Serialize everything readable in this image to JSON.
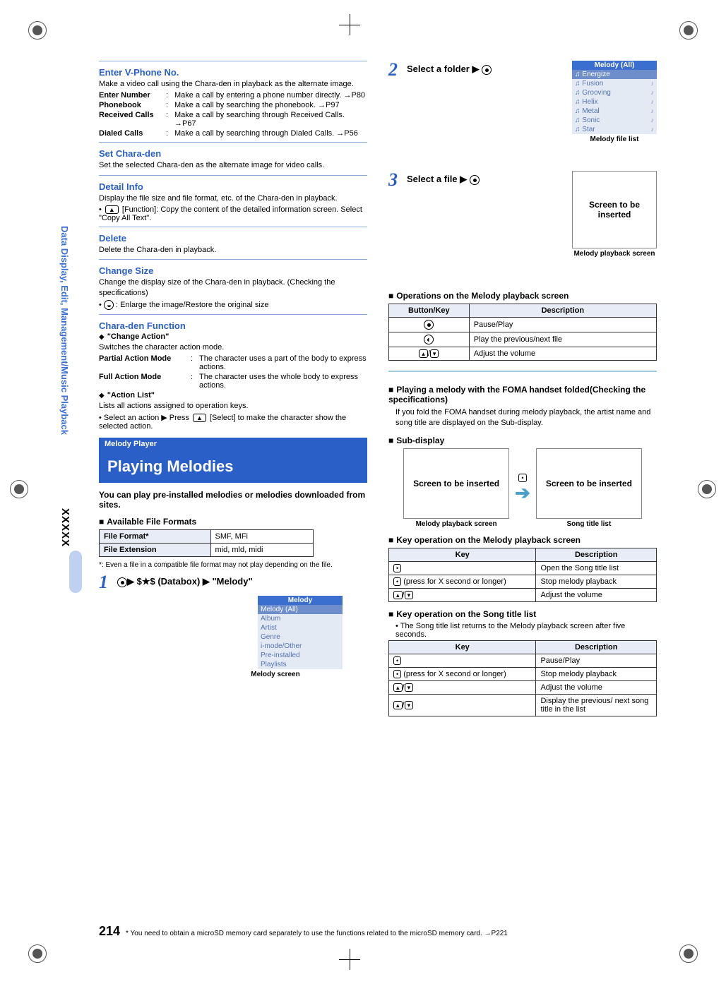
{
  "side": {
    "section": "Data Display, Edit, Management/Music Playback",
    "subcode": "XXXXX"
  },
  "left": {
    "vphone": {
      "title": "Enter V-Phone No.",
      "desc": "Make a video call using the Chara-den in playback as the alternate image.",
      "rows": [
        {
          "k": "Enter Number",
          "v": "Make a call by entering a phone number directly. →P80"
        },
        {
          "k": "Phonebook",
          "v": "Make a call by searching the phonebook. →P97"
        },
        {
          "k": "Received Calls",
          "v": "Make a call by searching through Received Calls. →P67"
        },
        {
          "k": "Dialed Calls",
          "v": "Make a call by searching through Dialed Calls. →P56"
        }
      ]
    },
    "setchara": {
      "title": "Set Chara-den",
      "desc": "Set the selected Chara-den as the alternate image for video calls."
    },
    "detail": {
      "title": "Detail Info",
      "desc": "Display the file size and file format, etc. of the Chara-den in playback.",
      "bullet_pre": "•",
      "bullet_post": " [Function]: Copy the content of the detailed information screen. Select \"Copy All Text\"."
    },
    "delete": {
      "title": "Delete",
      "desc": "Delete the Chara-den in playback."
    },
    "changesize": {
      "title": "Change Size",
      "desc": "Change the display size of the Chara-den in playback. (Checking the specifications)",
      "bullet": ": Enlarge the image/Restore the original size"
    },
    "charafn": {
      "title": "Chara-den Function",
      "changeaction": "\"Change Action\"",
      "changeaction_desc": "Switches the character action mode.",
      "rows": [
        {
          "k": "Partial Action Mode",
          "v": "The character uses a part of the body to express actions."
        },
        {
          "k": "Full Action Mode",
          "v": "The character uses the whole body to express actions."
        }
      ],
      "actionlist": "\"Action List\"",
      "actionlist_desc": "Lists all actions assigned to operation keys.",
      "actionlist_bullet": "Select an action ▶ Press ",
      "actionlist_bullet2": " [Select] to make the character show the selected action."
    },
    "feature": {
      "bar": "Melody Player",
      "title": "Playing Melodies",
      "lead": "You can play pre-installed melodies or melodies downloaded from sites.",
      "avail_head": "Available File Formats",
      "table": {
        "r1k": "File Format*",
        "r1v": "SMF, MFi",
        "r2k": "File Extension",
        "r2v": "mid, mld, midi"
      },
      "foot": "*: Even a file in a compatible file format may not play depending on the file.",
      "step1": "$★$ (Databox)  ▶  \"Melody\"",
      "menu_title": "Melody",
      "menu_items": [
        "Melody (All)",
        "Album",
        "Artist",
        "Genre",
        "i-mode/Other",
        "Pre-installed",
        "Playlists"
      ],
      "menu_caption": "Melody screen"
    }
  },
  "right": {
    "step2": "Select a folder ▶",
    "step3": "Select a file ▶",
    "list_title": "Melody (All)",
    "list_items": [
      "Energize",
      "Fusion",
      "Grooving",
      "Helix",
      "Metal",
      "Sonic",
      "Star"
    ],
    "list_caption": "Melody file list",
    "screen_placeholder": "Screen to be inserted",
    "playback_caption": "Melody playback screen",
    "ops_head": "Operations on the Melody playback screen",
    "ops_table": {
      "h1": "Button/Key",
      "h2": "Description",
      "rows": [
        {
          "d": "Pause/Play"
        },
        {
          "d": "Play the previous/next file"
        },
        {
          "d": "Adjust the volume"
        }
      ]
    },
    "fold_head": "Playing a melody with the FOMA handset folded(Checking the specifications)",
    "fold_desc": "If you fold the FOMA handset during melody playback, the artist name and song title are displayed on the Sub-display.",
    "subdisp_head": "Sub-display",
    "subcap_left": "Melody playback screen",
    "subcap_right": "Song title list",
    "keyop1_head": "Key operation on the Melody playback screen",
    "keyop_h1": "Key",
    "keyop_h2": "Description",
    "keyop1_rows": [
      {
        "d": "Open the Song title list"
      },
      {
        "k_suffix": "(press for X second or longer)",
        "d": "Stop melody playback"
      },
      {
        "d": "Adjust the volume"
      }
    ],
    "keyop2_head": "Key operation on the Song title list",
    "keyop2_note": "The Song title list returns to the Melody playback screen after five seconds.",
    "keyop2_rows": [
      {
        "d": "Pause/Play"
      },
      {
        "k_suffix": "(press for X second or longer)",
        "d": "Stop melody playback"
      },
      {
        "d": "Adjust the volume"
      },
      {
        "d": "Display the previous/ next song title in the list"
      }
    ]
  },
  "footer": {
    "page": "214",
    "text": "* You need to obtain a microSD memory card separately to use the functions related to the microSD memory card. →P221"
  }
}
